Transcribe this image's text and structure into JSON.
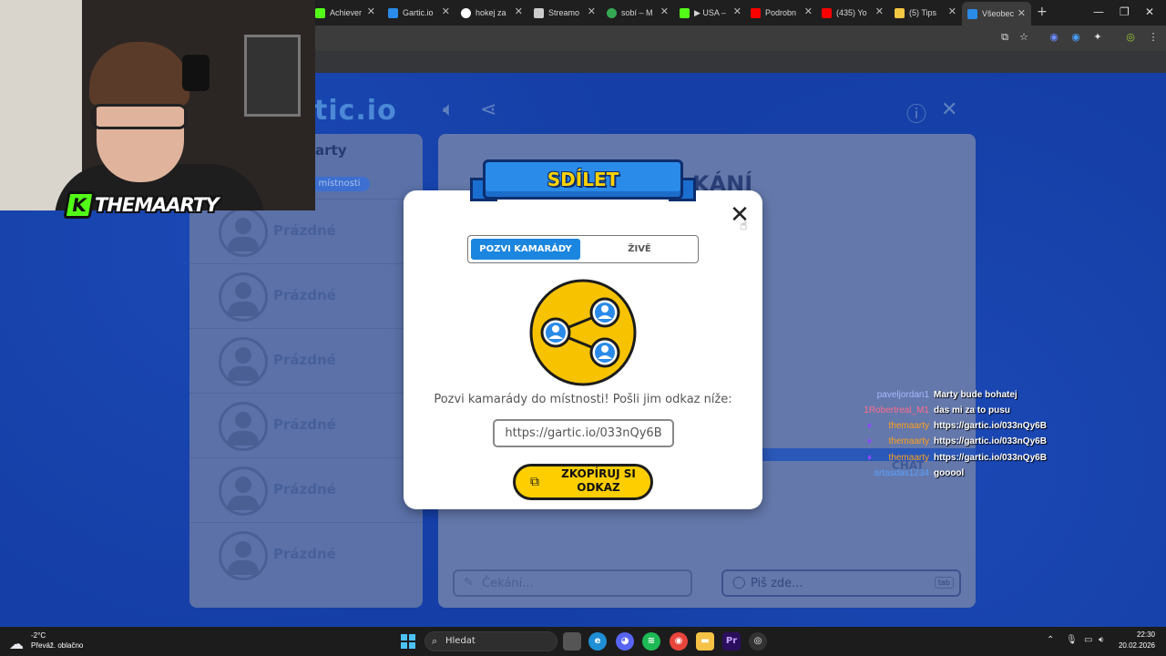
{
  "browser": {
    "tabs": [
      {
        "label": "Achiever",
        "color": "#53fc18"
      },
      {
        "label": "Gartic.io",
        "color": "#2a8be8"
      },
      {
        "label": "hokej za",
        "color": "#ffffff"
      },
      {
        "label": "Streamo",
        "color": "#cccccc"
      },
      {
        "label": "sobí – M",
        "color": "#34a853"
      },
      {
        "label": "▶ USA –",
        "color": "#53fc18"
      },
      {
        "label": "Podrobn",
        "color": "#ff0000"
      },
      {
        "label": "(435) Yo",
        "color": "#ff0000"
      },
      {
        "label": "(5) Tips",
        "color": "#f2c744"
      },
      {
        "label": "Všeobec",
        "color": "#2a8be8"
      }
    ],
    "new_tab": "+"
  },
  "game": {
    "logo": "tic.io",
    "player_name": "arty",
    "player_badge": "d místnosti",
    "slots": [
      "Prázdné",
      "Prázdné",
      "Prázdné",
      "Prázdné",
      "Prázdné",
      "Prázdné"
    ],
    "waiting_title": "KÁNÍ",
    "chat_label": "CHAT",
    "wait_input_placeholder": "Čekání...",
    "chat_input_placeholder": "Piš zde...",
    "tab_key": "tab"
  },
  "modal": {
    "title": "SDÍLET",
    "tab_invite": "POZVI KAMARÁDY",
    "tab_live": "ŽIVĚ",
    "invite_text": "Pozvi kamarády do místnosti! Pošli jim odkaz níže:",
    "link": "https://gartic.io/033nQy6B",
    "copy_line1": "ZKOPÍRUJ SI",
    "copy_line2": "ODKAZ"
  },
  "stream_chat": [
    {
      "user": "paveljordan1",
      "user_color": "#a9b8ff",
      "text": "Marty bude bohatej",
      "badge": false
    },
    {
      "user": "1Robertreal_M1",
      "user_color": "#ff6b8a",
      "text": "das mi za to pusu",
      "badge": false
    },
    {
      "user": "themaarty",
      "user_color": "#ff9f1c",
      "text": "https://gartic.io/033nQy6B",
      "badge": true
    },
    {
      "user": "themaarty",
      "user_color": "#ff9f1c",
      "text": "https://gartic.io/033nQy6B",
      "badge": true
    },
    {
      "user": "themaarty",
      "user_color": "#ff9f1c",
      "text": "https://gartic.io/033nQy6B",
      "badge": true
    },
    {
      "user": "artasdas1234",
      "user_color": "#5aa0ff",
      "text": "gooool",
      "badge": false
    }
  ],
  "webcam": {
    "channel_name": "THEMAARTY",
    "badge_letter": "K"
  },
  "taskbar": {
    "temperature": "-2°C",
    "weather": "Převáž. oblačno",
    "search": "Hledat",
    "time": "22:30",
    "date": "20.02.2026"
  }
}
